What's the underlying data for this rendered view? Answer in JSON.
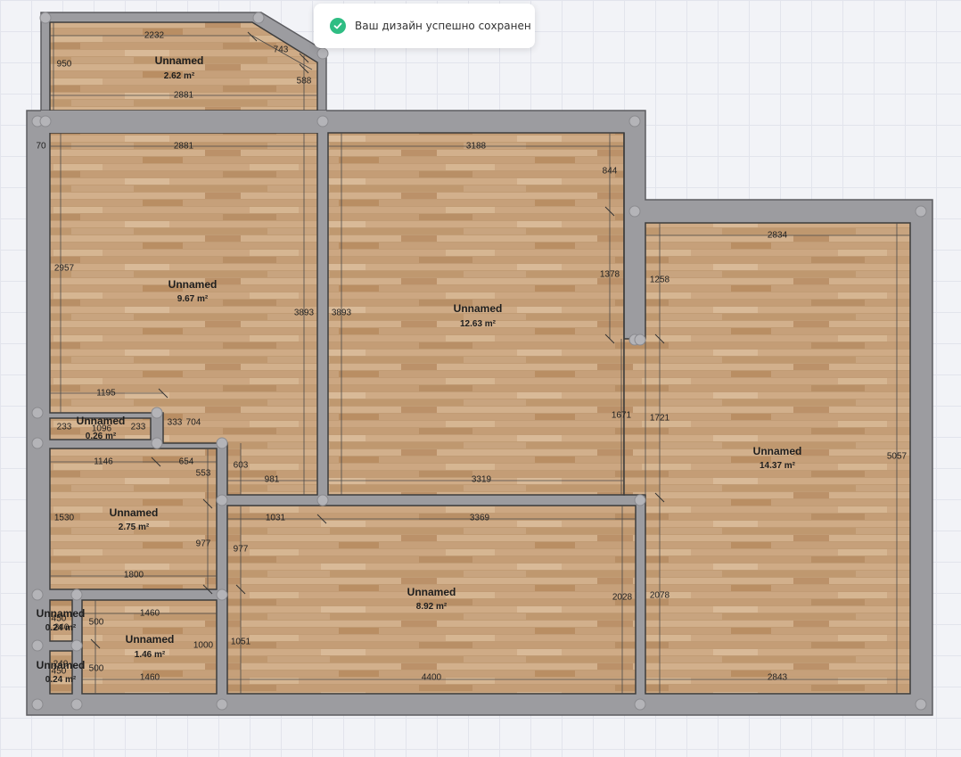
{
  "toast": {
    "message": "Ваш дизайн успешно сохранен",
    "icon": "check-circle-icon",
    "color": "#2fbd83"
  },
  "rooms": [
    {
      "name": "Unnamed",
      "area": "2.62 m²"
    },
    {
      "name": "Unnamed",
      "area": "9.67 m²"
    },
    {
      "name": "Unnamed",
      "area": "12.63 m²"
    },
    {
      "name": "Unnamed",
      "area": "14.37 m²"
    },
    {
      "name": "Unnamed",
      "area": "0.26 m²"
    },
    {
      "name": "Unnamed",
      "area": "2.75 m²"
    },
    {
      "name": "Unnamed",
      "area": "8.92 m²"
    },
    {
      "name": "Unnamed",
      "area": "1.46 m²"
    },
    {
      "name": "Unnamed",
      "area": "0.24 m²"
    },
    {
      "name": "Unnamed",
      "area": "0.24 m²"
    }
  ],
  "dimensions": [
    "2232",
    "743",
    "950",
    "588",
    "2881",
    "70",
    "2881",
    "3188",
    "844",
    "2957",
    "3893",
    "3893",
    "1378",
    "1258",
    "2834",
    "1195",
    "1096",
    "233",
    "233",
    "333",
    "704",
    "1146",
    "654",
    "553",
    "603",
    "981",
    "3319",
    "1671",
    "1721",
    "5057",
    "1530",
    "977",
    "1031",
    "3369",
    "977",
    "1800",
    "1460",
    "500",
    "240",
    "450",
    "1000",
    "1051",
    "2028",
    "2078",
    "500",
    "240",
    "450",
    "1460",
    "4400",
    "2843"
  ],
  "colors": {
    "wall": "#9c9ca0",
    "floor": "#c9a37c",
    "background": "#f2f3f7"
  }
}
